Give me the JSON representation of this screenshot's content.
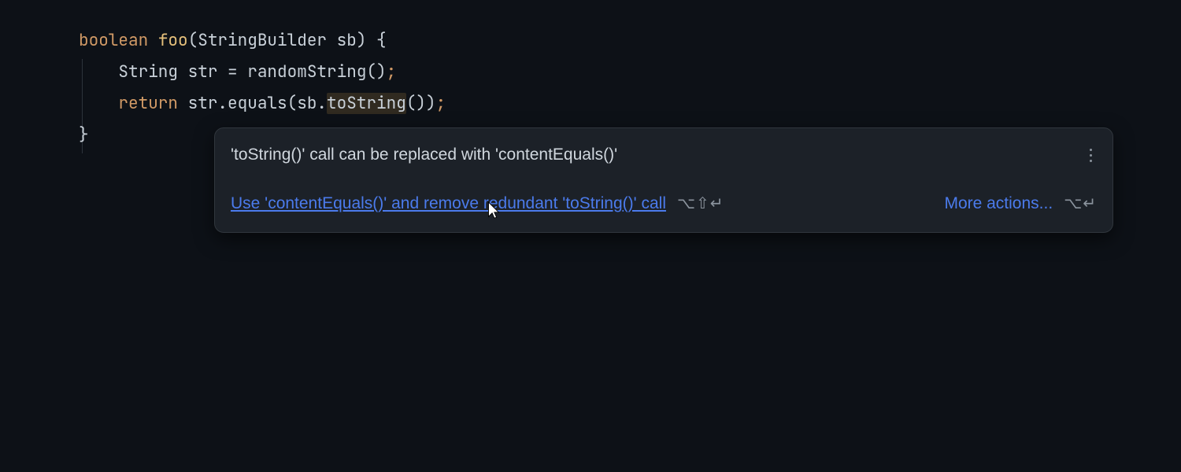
{
  "code": {
    "line1": {
      "kw": "boolean",
      "fn": "foo",
      "params_open": "(",
      "param_type": "StringBuilder",
      "param_name": " sb",
      "params_close": ") {"
    },
    "line2": {
      "indent": "    ",
      "type": "String",
      "var": " str ",
      "eq": "= ",
      "call": "randomString()",
      "semi": ";"
    },
    "line3": {
      "indent": "    ",
      "kw": "return",
      "expr1": " str.equals(sb.",
      "hl": "toString",
      "expr2": "())",
      "semi": ";"
    },
    "line4": {
      "brace": "}"
    }
  },
  "popup": {
    "title": "'toString()' call can be replaced with 'contentEquals()'",
    "primary_action": "Use 'contentEquals()' and remove redundant 'toString()' call",
    "primary_shortcut": "⌥⇧↵",
    "more_label": "More actions...",
    "more_shortcut": "⌥↵"
  }
}
